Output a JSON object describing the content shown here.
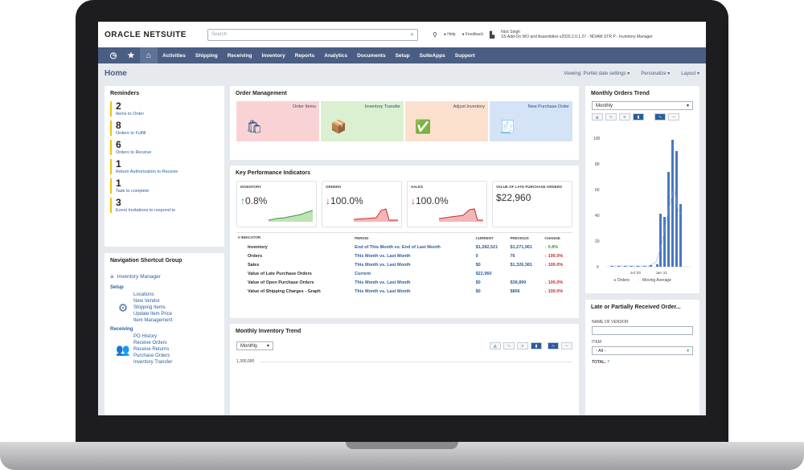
{
  "header": {
    "logo": "ORACLE NETSUITE",
    "search_placeholder": "Search",
    "help_label": "Help",
    "feedback_label": "Feedback",
    "user_name": "Nick Singh",
    "user_role": "SS Add-On WO and Assemblies v2020.2.0.1.27 - NDIAM STR P - Inventory Manager"
  },
  "nav": {
    "items": [
      "Activities",
      "Shipping",
      "Receiving",
      "Inventory",
      "Reports",
      "Analytics",
      "Documents",
      "Setup",
      "SuiteApps",
      "Support"
    ]
  },
  "subbar": {
    "title": "Home",
    "viewing": "Viewing: Portlet date settings",
    "personalize": "Personalize",
    "layout": "Layout"
  },
  "reminders": {
    "title": "Reminders",
    "items": [
      {
        "count": "2",
        "label": "Items to Order"
      },
      {
        "count": "8",
        "label": "Orders to Fulfill"
      },
      {
        "count": "6",
        "label": "Orders to Receive"
      },
      {
        "count": "1",
        "label": "Return Authorization to Receive"
      },
      {
        "count": "1",
        "label": "Task to complete"
      },
      {
        "count": "3",
        "label": "Event Invitations to respond to"
      }
    ]
  },
  "nav_shortcuts": {
    "title": "Navigation Shortcut Group",
    "group": "Inventory Manager",
    "setup_label": "Setup",
    "setup_links": [
      "Locations",
      "New Vendor",
      "Shipping Items",
      "Update Item Price",
      "Item Management"
    ],
    "receiving_label": "Receiving",
    "receiving_links": [
      "PO History",
      "Receive Orders",
      "Receive Returns",
      "Purchase Orders",
      "Inventory Transfer"
    ]
  },
  "order_mgmt": {
    "title": "Order Management",
    "tiles": [
      "Order Items",
      "Inventory Transfer",
      "Adjust Inventory",
      "New Purchase Order"
    ],
    "tile_colors": [
      "#f9d3d4",
      "#daf0d0",
      "#fbe0cd",
      "#d4e3f6"
    ]
  },
  "kpi": {
    "title": "Key Performance Indicators",
    "cards": [
      {
        "name": "INVENTORY",
        "value": "0.8%",
        "arrow": "↑",
        "trend": "up"
      },
      {
        "name": "ORDERS",
        "value": "100.0%",
        "arrow": "↓",
        "trend": "down"
      },
      {
        "name": "SALES",
        "value": "100.0%",
        "arrow": "↓",
        "trend": "down"
      },
      {
        "name": "VALUE OF LATE PURCHASE ORDERS",
        "value": "$22,960",
        "arrow": "",
        "trend": "none"
      }
    ],
    "columns": [
      "INDICATOR",
      "PERIOD",
      "CURRENT",
      "PREVIOUS",
      "CHANGE"
    ],
    "rows": [
      {
        "indicator": "Inventory",
        "period": "End of This Month vs. End of Last Month",
        "current": "$1,282,521",
        "previous": "$1,271,961",
        "change": "↑ 0.8%"
      },
      {
        "indicator": "Orders",
        "period": "This Month vs. Last Month",
        "current": "0",
        "previous": "76",
        "change": "↓ 100.0%"
      },
      {
        "indicator": "Sales",
        "period": "This Month vs. Last Month",
        "current": "$0",
        "previous": "$1,326,381",
        "change": "↓ 100.0%"
      },
      {
        "indicator": "Value of Late Purchase Orders",
        "period": "Current",
        "current": "$22,960",
        "previous": "",
        "change": ""
      },
      {
        "indicator": "Value of Open Purchase Orders",
        "period": "This Month vs. Last Month",
        "current": "$0",
        "previous": "$38,890",
        "change": "↓ 100.0%"
      },
      {
        "indicator": "Value of Shipping Charges - Graph",
        "period": "This Month vs. Last Month",
        "current": "$0",
        "previous": "$866",
        "change": "↓ 100.0%"
      }
    ]
  },
  "inv_trend": {
    "title": "Monthly Inventory Trend",
    "period": "Monthly",
    "first_tick": "1,300,000"
  },
  "orders_trend": {
    "title": "Monthly Orders Trend",
    "period": "Monthly",
    "y_ticks": [
      "100",
      "80",
      "60",
      "40",
      "20",
      "0"
    ],
    "x_ticks": [
      "Jul '20",
      "Jan '21"
    ],
    "legend_orders": "Orders",
    "legend_avg": "Moving Average"
  },
  "late_orders": {
    "title": "Late or Partially Received Order...",
    "vendor_label": "NAME OF VENDOR",
    "item_label": "ITEM",
    "item_value": "- All -",
    "total_label": "TOTAL:",
    "total_value": "7"
  }
}
